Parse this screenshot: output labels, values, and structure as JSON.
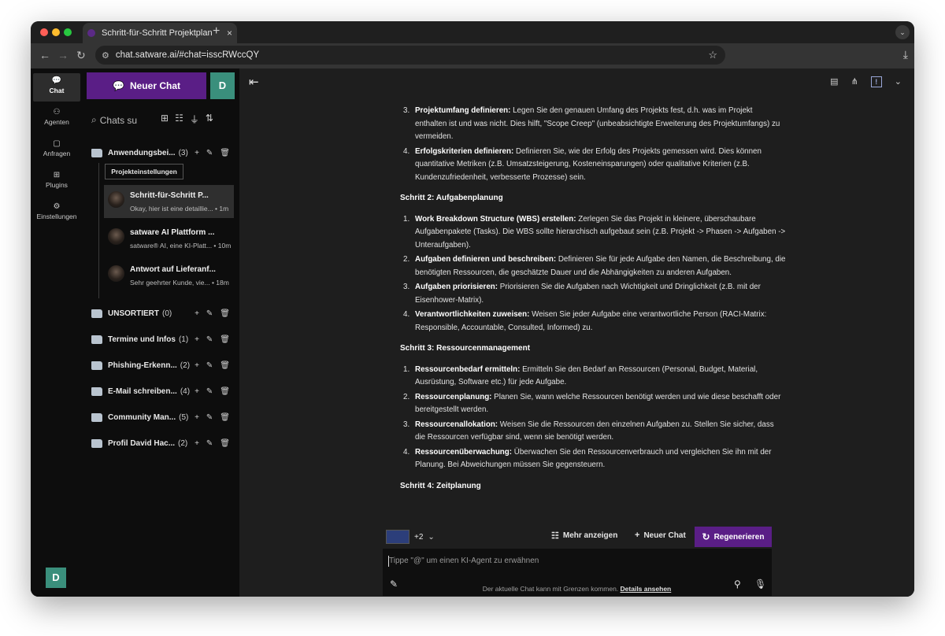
{
  "browser": {
    "tab_title": "Schritt-für-Schritt Projektplan",
    "tab_close": "×",
    "new_tab": "+",
    "url": "chat.satware.ai/#chat=isscRWccQY",
    "icons": [
      "back-icon",
      "forward-icon",
      "reload-icon",
      "site-settings-icon",
      "star-icon",
      "download-icon",
      "tab-menu-icon"
    ]
  },
  "rail": {
    "items": [
      {
        "label": "Chat",
        "icon": "chat-icon"
      },
      {
        "label": "Agenten",
        "icon": "agents-icon"
      },
      {
        "label": "Anfragen",
        "icon": "prompts-icon"
      },
      {
        "label": "Plugins",
        "icon": "plugins-icon"
      },
      {
        "label": "Einstellungen",
        "icon": "settings-icon"
      }
    ],
    "avatar_letter": "D"
  },
  "panel": {
    "new_chat_label": "Neuer Chat",
    "user_letter": "D",
    "search_placeholder": "Chats su",
    "tooltip": "Projekteinstellungen",
    "folders": [
      {
        "name": "Anwendungsbei...",
        "count": "(3)"
      },
      {
        "name": "UNSORTIERT",
        "count": "(0)"
      },
      {
        "name": "Termine und Infos",
        "count": "(1)"
      },
      {
        "name": "Phishing-Erkenn...",
        "count": "(2)"
      },
      {
        "name": "E-Mail schreiben...",
        "count": "(4)"
      },
      {
        "name": "Community Man...",
        "count": "(5)"
      },
      {
        "name": "Profil David Hac...",
        "count": "(2)"
      }
    ],
    "chats": [
      {
        "title": "Schritt-für-Schritt P...",
        "preview": "Okay, hier ist eine detaillie... • 1m"
      },
      {
        "title": "satware AI Plattform ...",
        "preview": "satware® AI, eine KI-Platt... • 10m"
      },
      {
        "title": "Antwort auf Lieferanf...",
        "preview": "Sehr geehrter Kunde, vie... • 18m"
      }
    ]
  },
  "main": {
    "content": {
      "sec1_items": [
        {
          "num": "3.",
          "bold": "Projektumfang definieren:",
          "text": " Legen Sie den genauen Umfang des Projekts fest, d.h. was im Projekt enthalten ist und was nicht. Dies hilft, \"Scope Creep\" (unbeabsichtigte Erweiterung des Projektumfangs) zu vermeiden."
        },
        {
          "num": "4.",
          "bold": "Erfolgskriterien definieren:",
          "text": " Definieren Sie, wie der Erfolg des Projekts gemessen wird. Dies können quantitative Metriken (z.B. Umsatzsteigerung, Kosteneinsparungen) oder qualitative Kriterien (z.B. Kundenzufriedenheit, verbesserte Prozesse) sein."
        }
      ],
      "heading2": "Schritt 2: Aufgabenplanung",
      "sec2_items": [
        {
          "num": "1.",
          "bold": "Work Breakdown Structure (WBS) erstellen:",
          "text": " Zerlegen Sie das Projekt in kleinere, überschaubare Aufgabenpakete (Tasks). Die WBS sollte hierarchisch aufgebaut sein (z.B. Projekt -> Phasen -> Aufgaben -> Unteraufgaben)."
        },
        {
          "num": "2.",
          "bold": "Aufgaben definieren und beschreiben:",
          "text": " Definieren Sie für jede Aufgabe den Namen, die Beschreibung, die benötigten Ressourcen, die geschätzte Dauer und die Abhängigkeiten zu anderen Aufgaben."
        },
        {
          "num": "3.",
          "bold": "Aufgaben priorisieren:",
          "text": " Priorisieren Sie die Aufgaben nach Wichtigkeit und Dringlichkeit (z.B. mit der Eisenhower-Matrix)."
        },
        {
          "num": "4.",
          "bold": "Verantwortlichkeiten zuweisen:",
          "text": " Weisen Sie jeder Aufgabe eine verantwortliche Person (RACI-Matrix: Responsible, Accountable, Consulted, Informed) zu."
        }
      ],
      "heading3": "Schritt 3: Ressourcenmanagement",
      "sec3_items": [
        {
          "num": "1.",
          "bold": "Ressourcenbedarf ermitteln:",
          "text": " Ermitteln Sie den Bedarf an Ressourcen (Personal, Budget, Material, Ausrüstung, Software etc.) für jede Aufgabe."
        },
        {
          "num": "2.",
          "bold": "Ressourcenplanung:",
          "text": " Planen Sie, wann welche Ressourcen benötigt werden und wie diese beschafft oder bereitgestellt werden."
        },
        {
          "num": "3.",
          "bold": "Ressourcenallokation:",
          "text": " Weisen Sie die Ressourcen den einzelnen Aufgaben zu. Stellen Sie sicher, dass die Ressourcen verfügbar sind, wenn sie benötigt werden."
        },
        {
          "num": "4.",
          "bold": "Ressourcenüberwachung:",
          "text": " Überwachen Sie den Ressourcenverbrauch und vergleichen Sie ihn mit der Planung. Bei Abweichungen müssen Sie gegensteuern."
        }
      ],
      "heading4": "Schritt 4: Zeitplanung"
    },
    "actions": {
      "models_extra": "+2",
      "more_label": "Mehr anzeigen",
      "new_chat_label": "Neuer Chat",
      "regenerate_label": "Regenerieren"
    },
    "input_placeholder": "Tippe \"@\" um einen KI-Agent zu erwähnen",
    "footer_text": "Der aktuelle Chat kann mit Grenzen kommen.",
    "footer_link": "Details ansehen"
  },
  "colors": {
    "accent": "#5a1e86",
    "avatar": "#3a8f7c",
    "background": "#1e1e1e",
    "sidebar": "#0d0d0d"
  }
}
